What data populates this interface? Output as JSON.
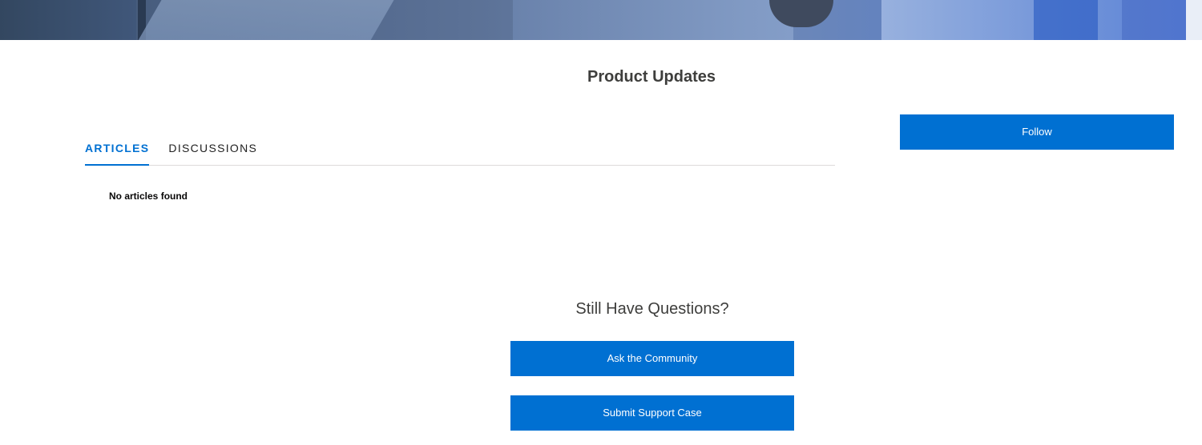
{
  "page": {
    "title": "Product Updates"
  },
  "tabs": [
    {
      "label": "ARTICLES",
      "active": true
    },
    {
      "label": "DISCUSSIONS",
      "active": false
    }
  ],
  "articles": {
    "empty_message": "No articles found"
  },
  "follow": {
    "label": "Follow"
  },
  "help": {
    "heading": "Still Have Questions?",
    "ask_label": "Ask the Community",
    "case_label": "Submit Support Case"
  },
  "colors": {
    "accent": "#0070d2",
    "text": "#3e3e3c"
  }
}
